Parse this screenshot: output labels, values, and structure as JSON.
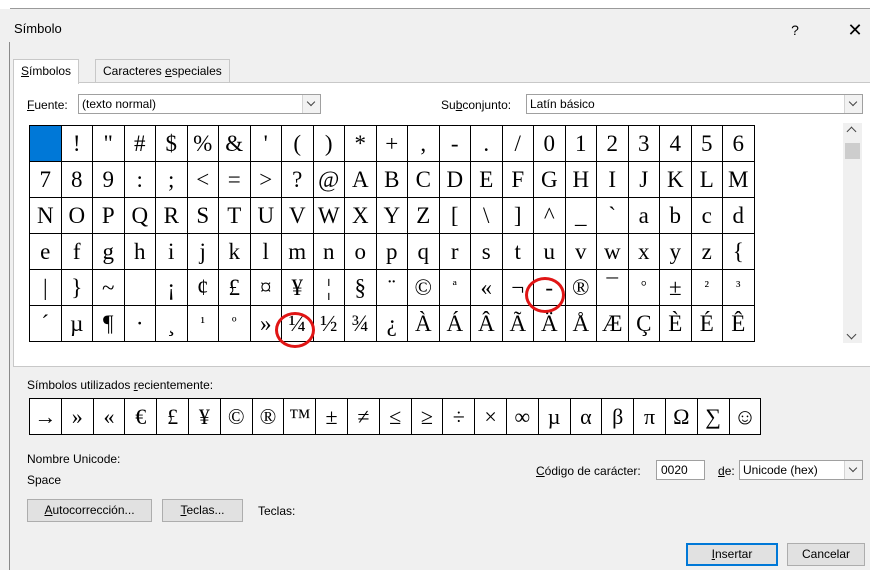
{
  "window": {
    "title": "Símbolo",
    "help": "?",
    "close": "✕"
  },
  "tabs": [
    {
      "pre": "",
      "key": "S",
      "post": "ímbolos"
    },
    {
      "pre": "Caracteres ",
      "key": "e",
      "post": "speciales"
    }
  ],
  "font": {
    "label_key": "F",
    "label_rest": "uente:",
    "value": "(texto normal)"
  },
  "subset": {
    "label_pre": "Su",
    "label_key": "b",
    "label_post": "conjunto:",
    "value": "Latín básico"
  },
  "symbols": [
    [
      " ",
      "!",
      "\"",
      "#",
      "$",
      "%",
      "&",
      "'",
      "(",
      ")",
      "*",
      "+",
      ",",
      "-",
      ".",
      "/",
      "0",
      "1",
      "2",
      "3",
      "4",
      "5",
      "6"
    ],
    [
      "7",
      "8",
      "9",
      ":",
      ";",
      "<",
      "=",
      ">",
      "?",
      "@",
      "A",
      "B",
      "C",
      "D",
      "E",
      "F",
      "G",
      "H",
      "I",
      "J",
      "K",
      "L",
      "M"
    ],
    [
      "N",
      "O",
      "P",
      "Q",
      "R",
      "S",
      "T",
      "U",
      "V",
      "W",
      "X",
      "Y",
      "Z",
      "[",
      "\\",
      "]",
      "^",
      "_",
      "`",
      "a",
      "b",
      "c",
      "d"
    ],
    [
      "e",
      "f",
      "g",
      "h",
      "i",
      "j",
      "k",
      "l",
      "m",
      "n",
      "o",
      "p",
      "q",
      "r",
      "s",
      "t",
      "u",
      "v",
      "w",
      "x",
      "y",
      "z",
      "{"
    ],
    [
      "|",
      "}",
      "~",
      "",
      "¡",
      "¢",
      "£",
      "¤",
      "¥",
      "¦",
      "§",
      "¨",
      "©",
      "ª",
      "«",
      "¬",
      "-",
      "®",
      "¯",
      "°",
      "±",
      "²",
      "³"
    ],
    [
      "´",
      "µ",
      "¶",
      "·",
      "¸",
      "¹",
      "º",
      "»",
      "¼",
      "½",
      "¾",
      "¿",
      "À",
      "Á",
      "Â",
      "Ã",
      "Ä",
      "Å",
      "Æ",
      "Ç",
      "È",
      "É",
      "Ê"
    ]
  ],
  "recent": {
    "label_pre": "Símbolos utilizados ",
    "label_key": "r",
    "label_post": "ecientemente:",
    "items": [
      "→",
      "»",
      "«",
      "€",
      "£",
      "¥",
      "©",
      "®",
      "™",
      "±",
      "≠",
      "≤",
      "≥",
      "÷",
      "×",
      "∞",
      "µ",
      "α",
      "β",
      "π",
      "Ω",
      "∑",
      "☺"
    ]
  },
  "unicode": {
    "label": "Nombre Unicode:",
    "value": "Space"
  },
  "charcode": {
    "label_pre": "",
    "label_key": "C",
    "label_post": "ódigo de carácter:",
    "value": "0020",
    "from_key": "d",
    "from_post": "e:",
    "from_value": "Unicode (hex)"
  },
  "buttons": {
    "autocorrect": {
      "key": "A",
      "post": "utocorrección..."
    },
    "shortcut": {
      "key": "T",
      "post": "eclas..."
    },
    "shortcut_label": "Teclas:",
    "insert": {
      "key": "I",
      "post": "nsertar"
    },
    "cancel": "Cancelar"
  }
}
